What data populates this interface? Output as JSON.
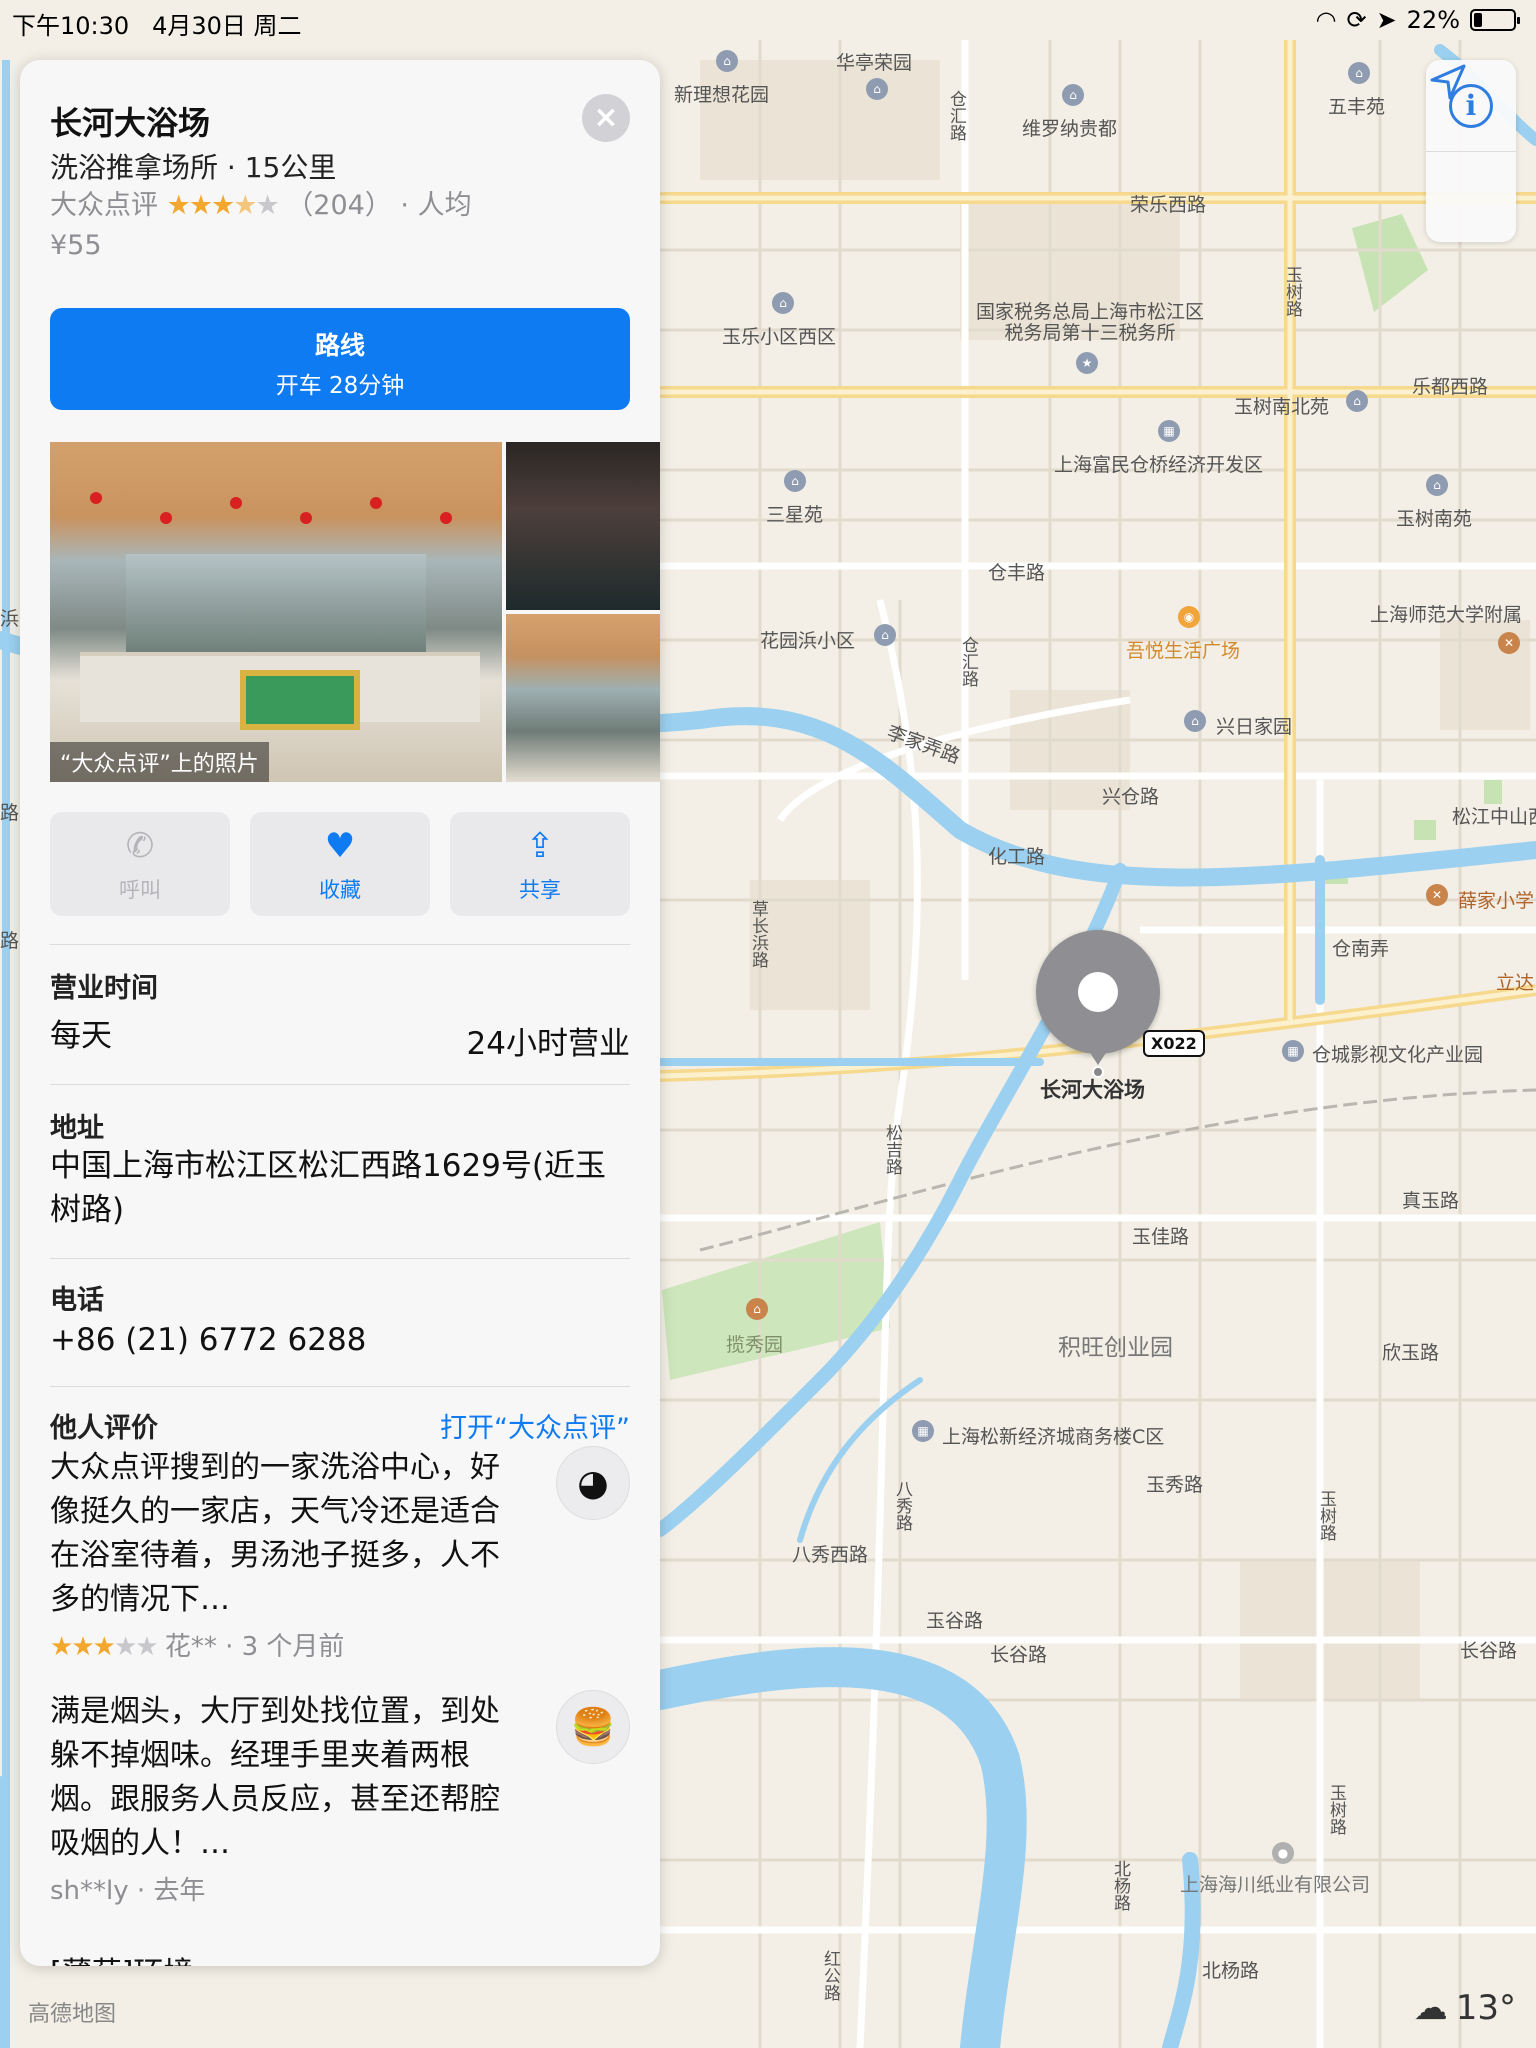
{
  "status": {
    "time": "下午10:30",
    "date": "4月30日 周二",
    "battery": "22%",
    "battery_level": 0.22
  },
  "map": {
    "labels": {
      "xinlixiang": "新理想花园",
      "huatingrong": "华亭荣园",
      "weiluona": "维罗纳贵都",
      "wufengyuan": "五丰苑",
      "rongle_xilu": "荣乐西路",
      "yule_xiqu": "玉乐小区西区",
      "tax_bureau": "国家税务总局上海市松江区税务局第十三税务所",
      "yushu_lu": "玉树路",
      "ledu_xilu": "乐都西路",
      "yushu_nanbei": "玉树南北苑",
      "fumin": "上海富民仓桥经济开发区",
      "sanxingyuan": "三星苑",
      "yushu_nanyuan": "玉树南苑",
      "cangfeng_lu": "仓丰路",
      "shida": "上海师范大学附属",
      "huayuanbang": "花园浜小区",
      "wuyue": "吾悦生活广场",
      "xingri": "兴日家园",
      "lijianong_lu": "李家弄路",
      "canghui_lu": "仓汇路",
      "xingcang_lu": "兴仓路",
      "songjiang_zhongshan": "松江中山西",
      "huagong_lu": "化工路",
      "caochangbang_lu": "草长浜路",
      "xuejia": "薛家小学",
      "cangnan_nong": "仓南弄",
      "lida": "立达",
      "cangcheng_film": "仓城影视文化产业园",
      "songji_lu": "松吉路",
      "zhenyu_lu": "真玉路",
      "yujia_lu": "玉佳路",
      "jiwang": "积旺创业园",
      "lanxiuyuan": "揽秀园",
      "xinyu_lu": "欣玉路",
      "songxin": "上海松新经济城商务楼C区",
      "yuxiu_lu": "玉秀路",
      "baxiu_lu": "八秀路",
      "baxiu_xilu": "八秀西路",
      "yugu_lu": "玉谷路",
      "changgu_lu": "长谷路",
      "changgu_lu2": "长谷路",
      "haichuan": "上海海川纸业有限公司",
      "beiyang_lu": "北杨路",
      "beiyang_lu2": "北杨路",
      "honggong_lu": "红公路",
      "left_lu1": "路",
      "left_lu2": "路",
      "left_bang": "浜"
    },
    "pin_label": "长河大浴场",
    "road_shield": "X022",
    "gaode": "高德地图",
    "weather_temp": "13°"
  },
  "card": {
    "title": "长河大浴场",
    "subtitle": "洗浴推拿场所 · 15公里",
    "rating_source": "大众点评",
    "rating_value": 3.5,
    "rating_count": "（204）",
    "per_person_label": "· 人均",
    "price": "¥55",
    "route_label": "路线",
    "route_detail": "开车 28分钟",
    "photo_caption": "“大众点评”上的照片",
    "actions": {
      "call": "呼叫",
      "favorite": "收藏",
      "share": "共享"
    },
    "hours_header": "营业时间",
    "hours_day": "每天",
    "hours_value": "24小时营业",
    "address_header": "地址",
    "address": "中国上海市松江区松汇西路1629号(近玉树路)",
    "phone_header": "电话",
    "phone": "+86 (21) 6772 6288",
    "reviews_header": "他人评价",
    "reviews_link": "打开“大众点评”",
    "reviews": [
      {
        "text": "大众点评搜到的一家洗浴中心，好像挺久的一家店，天气冷还是适合在浴室待着，男汤池子挺多，人不多的情况下…",
        "rating": 3,
        "meta": "花** · 3 个月前"
      },
      {
        "text": "满是烟头，大厅到处找位置，到处躲不掉烟味。经理手里夹着两根烟。跟服务人员反应，甚至还帮腔吸烟的人！…",
        "meta": "sh**ly · 去年"
      }
    ],
    "review3_partial": "[薄荷]环境:"
  }
}
